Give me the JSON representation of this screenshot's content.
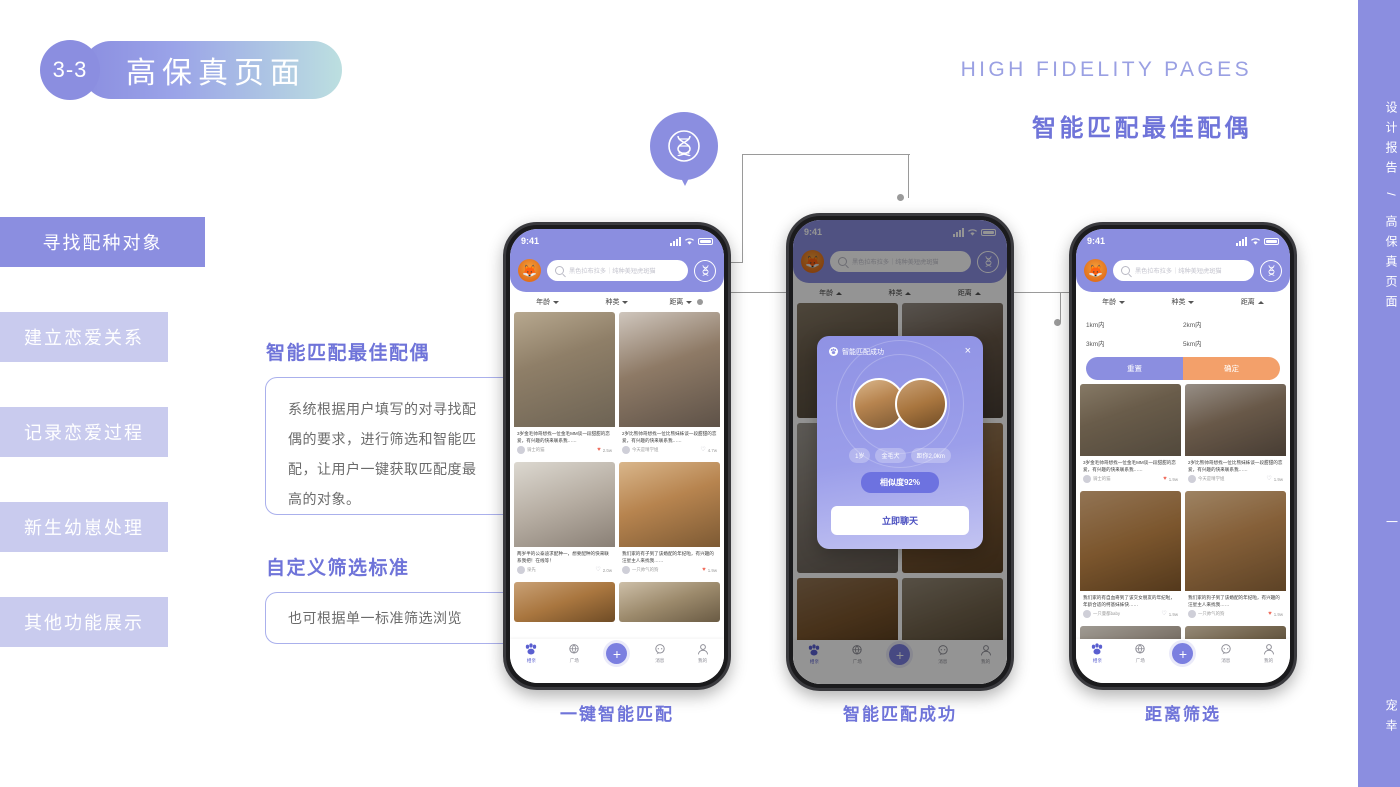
{
  "header": {
    "section_number": "3-3",
    "section_title": "高保真页面",
    "title_en": "HIGH FIDELITY PAGES",
    "title_cn": "智能匹配最佳配偶"
  },
  "left_nav": {
    "items": [
      {
        "label": "寻找配种对象",
        "active": true
      },
      {
        "label": "建立恋爱关系",
        "active": false
      },
      {
        "label": "记录恋爱过程",
        "active": false
      },
      {
        "label": "新生幼崽处理",
        "active": false
      },
      {
        "label": "其他功能展示",
        "active": false
      }
    ]
  },
  "descriptions": [
    {
      "heading": "智能匹配最佳配偶",
      "body": "系统根据用户填写的对寻找配偶的要求，进行筛选和智能匹配，让用户一键获取匹配度最高的对象。"
    },
    {
      "heading": "自定义筛选标准",
      "body": "也可根据单一标准筛选浏览"
    }
  ],
  "callout": {
    "icon": "dna-icon"
  },
  "phones": [
    {
      "caption": "一键智能匹配",
      "status": {
        "time": "9:41"
      },
      "search_placeholder": "黑色拉布拉多｜纯种美短虎斑猫",
      "filters": [
        {
          "label": "年龄",
          "state": "down"
        },
        {
          "label": "种类",
          "state": "down"
        },
        {
          "label": "距离",
          "state": "down"
        }
      ],
      "has_gear": true,
      "cards": [
        {
          "text": "3岁金毛帅哥想找一位金毛MM谈一段甜甜的恋爱，有兴趣的快来联系我……",
          "user": "骑士的猫",
          "likes": "2.5w",
          "liked": true
        },
        {
          "text": "2岁比熊帅哥想找一位比熊妹妹谈一段甜甜的恋爱，有兴趣的快来联系我……",
          "user": "今天是晴学姐",
          "likes": "4.7w",
          "liked": false
        },
        {
          "text": "两岁半的公泰迪求配种一，想要配种的快来联系我把！在线等！",
          "user": "泉先",
          "likes": "2.0w",
          "liked": false
        },
        {
          "text": "我们家的有子到了该婚配的年纪啦，有兴趣的汪星主人来找我……",
          "user": "一只帅气的狗",
          "likes": "1.9w",
          "liked": true
        }
      ],
      "tabs": [
        {
          "label": "相亲",
          "icon": "paw-icon",
          "active": true
        },
        {
          "label": "广场",
          "icon": "plaza-icon",
          "active": false
        },
        {
          "label": "",
          "icon": "plus-icon",
          "active": false
        },
        {
          "label": "消息",
          "icon": "message-icon",
          "active": false
        },
        {
          "label": "我的",
          "icon": "profile-icon",
          "active": false
        }
      ]
    },
    {
      "caption": "智能匹配成功",
      "status": {
        "time": "9:41"
      },
      "search_placeholder": "黑色拉布拉多｜纯种美短虎斑猫",
      "filters": [
        {
          "label": "年龄",
          "state": "up"
        },
        {
          "label": "种类",
          "state": "up"
        },
        {
          "label": "距离",
          "state": "up"
        }
      ],
      "has_gear": false,
      "modal": {
        "title": "智能匹配成功",
        "close": "×",
        "tags": [
          "1岁",
          "金毛犬",
          "距你2.0km"
        ],
        "score": "相似度92%",
        "action": "立即聊天"
      },
      "tabs": [
        {
          "label": "相亲",
          "icon": "paw-icon",
          "active": true
        },
        {
          "label": "广场",
          "icon": "plaza-icon",
          "active": false
        },
        {
          "label": "",
          "icon": "plus-icon",
          "active": false
        },
        {
          "label": "消息",
          "icon": "message-icon",
          "active": false
        },
        {
          "label": "我的",
          "icon": "profile-icon",
          "active": false
        }
      ]
    },
    {
      "caption": "距离筛选",
      "status": {
        "time": "9:41"
      },
      "search_placeholder": "黑色拉布拉多｜纯种美短虎斑猫",
      "filters": [
        {
          "label": "年龄",
          "state": "down"
        },
        {
          "label": "种类",
          "state": "down"
        },
        {
          "label": "距离",
          "state": "up"
        }
      ],
      "has_gear": false,
      "distance_dropdown": {
        "options": [
          "1km内",
          "2km内",
          "3km内",
          "5km内"
        ],
        "reset": "重置",
        "confirm": "确定"
      },
      "cards": [
        {
          "text": "3岁金毛帅哥想找一位金毛MM谈一段甜甜的恋爱，有兴趣的快来联系我……",
          "user": "骑士的猫",
          "likes": "1.9w",
          "liked": true
        },
        {
          "text": "2岁比熊帅哥想找一位比熊妹妹谈一段甜甜的恋爱，有兴趣的快来联系我……",
          "user": "今天是晴学姐",
          "likes": "1.9w",
          "liked": false
        },
        {
          "text": "我们家的有自血奇到了该交女朋友的年纪啦，年龄合适的柯基妹妹快……",
          "user": "一只曼都baby",
          "likes": "1.9w",
          "liked": false
        },
        {
          "text": "我们家的狗子到了该婚配的年纪啦，有兴趣的汪星主人来找我……",
          "user": "一只帅气的狗",
          "likes": "1.9w",
          "liked": true
        }
      ],
      "tabs": [
        {
          "label": "相亲",
          "icon": "paw-icon",
          "active": true
        },
        {
          "label": "广场",
          "icon": "plaza-icon",
          "active": false
        },
        {
          "label": "",
          "icon": "plus-icon",
          "active": false
        },
        {
          "label": "消息",
          "icon": "message-icon",
          "active": false
        },
        {
          "label": "我的",
          "icon": "profile-icon",
          "active": false
        }
      ]
    }
  ],
  "right_rail": {
    "main": "设计报告 / 高保真页面",
    "divider": "|",
    "brand": "宠幸"
  },
  "colors": {
    "primary": "#8b8ee0",
    "primary_dark": "#6f74d9",
    "nav_inactive": "#c9cbee",
    "accent_orange": "#f3a06a",
    "white": "#ffffff"
  }
}
